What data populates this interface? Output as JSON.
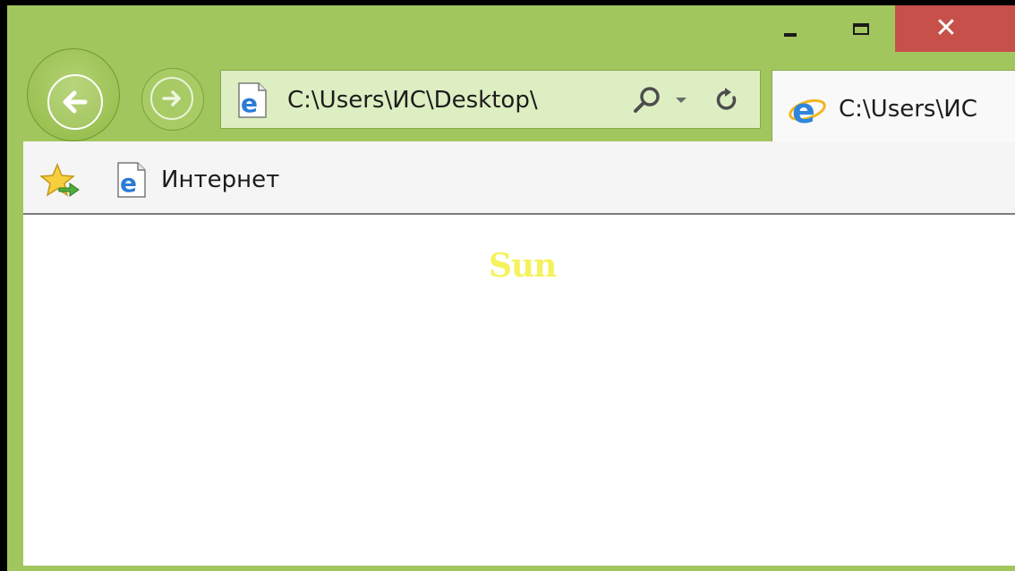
{
  "window": {
    "controls": {
      "minimize_icon": "minimize-icon",
      "maximize_icon": "maximize-icon",
      "close_icon": "close-icon",
      "close_glyph": "✕",
      "close_color": "#c7504a"
    },
    "frame_color": "#a2c65e"
  },
  "navigation": {
    "back_icon": "back-arrow-icon",
    "forward_icon": "forward-arrow-icon"
  },
  "address_bar": {
    "page_icon": "ie-page-icon",
    "url": "C:\\Users\\ИС\\Desktop\\",
    "search_icon": "search-icon",
    "dropdown_icon": "dropdown-arrow-icon",
    "refresh_icon": "refresh-icon"
  },
  "tab": {
    "icon": "ie-logo-icon",
    "label": "C:\\Users\\ИС"
  },
  "favorites_bar": {
    "add_favorites_icon": "add-favorites-star-icon",
    "site_icon": "ie-page-icon",
    "site_label": "Интернет"
  },
  "content": {
    "text": "Sun",
    "text_color": "#f5f25e"
  }
}
